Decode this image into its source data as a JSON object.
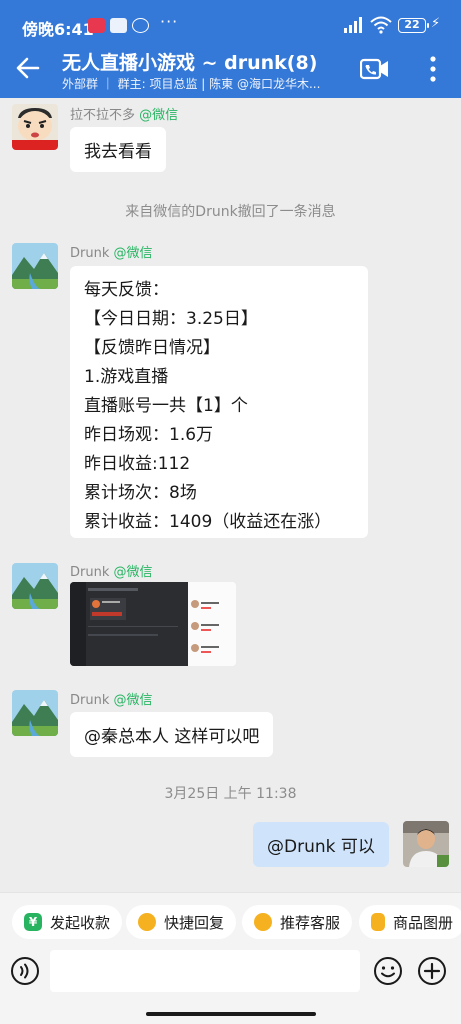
{
  "status_bar": {
    "time": "傍晚6:41",
    "battery": "22"
  },
  "header": {
    "title": "无人直播小游戏 ~ drunk(8)",
    "subtitle": "外部群 ｜ 群主: 项目总监 | 陈東 @海口龙华木..."
  },
  "messages": [
    {
      "sender": "拉不拉不多",
      "tag": "@微信",
      "text": "我去看看"
    },
    {
      "system": "来自微信的Drunk撤回了一条消息"
    },
    {
      "sender": "Drunk",
      "tag": "@微信",
      "lines": [
        "每天反馈：",
        "【今日日期：3.25日】",
        "【反馈昨日情况】",
        "1.游戏直播",
        "直播账号一共【1】个",
        "昨日场观：1.6万",
        "昨日收益:112",
        "累计场次：8场",
        "累计收益：1409（收益还在涨）"
      ]
    },
    {
      "sender": "Drunk",
      "tag": "@微信",
      "image": "screenshot"
    },
    {
      "sender": "Drunk",
      "tag": "@微信",
      "text": "@秦总本人 这样可以吧"
    },
    {
      "timestamp": "3月25日  上午 11:38"
    },
    {
      "me": true,
      "text": "@Drunk 可以"
    }
  ],
  "quick_actions": [
    {
      "label": "发起收款",
      "color": "#27b35f"
    },
    {
      "label": "快捷回复",
      "color": "#f5b120"
    },
    {
      "label": "推荐客服",
      "color": "#f5b120"
    },
    {
      "label": "商品图册",
      "color": "#f5b120"
    }
  ],
  "colors": {
    "header": "#3478d8",
    "wechat_tag": "#28b563",
    "my_bubble": "#cfe4fb"
  }
}
